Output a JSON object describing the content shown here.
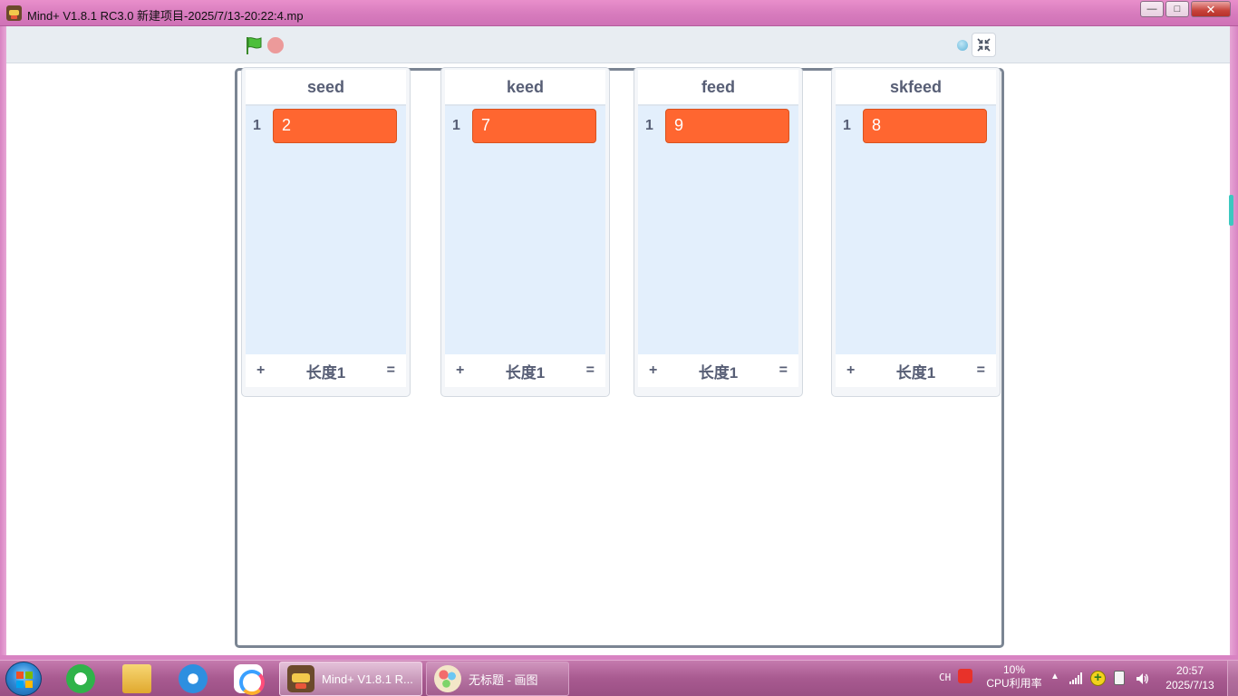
{
  "window": {
    "title": "Mind+ V1.8.1 RC3.0   新建项目-2025/7/13-20:22:4.mp",
    "minimize": "—",
    "maximize": "□",
    "close": "✕"
  },
  "toolbar": {
    "green_flag_icon": "green-flag-icon",
    "stop_icon": "stop-icon",
    "fullscreen_icon": "shrink-icon"
  },
  "lists": [
    {
      "name": "seed",
      "items": [
        {
          "index": "1",
          "value": "2"
        }
      ],
      "add": "+",
      "length": "长度1",
      "resize": "="
    },
    {
      "name": "keed",
      "items": [
        {
          "index": "1",
          "value": "7"
        }
      ],
      "add": "+",
      "length": "长度1",
      "resize": "="
    },
    {
      "name": "feed",
      "items": [
        {
          "index": "1",
          "value": "9"
        }
      ],
      "add": "+",
      "length": "长度1",
      "resize": "="
    },
    {
      "name": "skfeed",
      "items": [
        {
          "index": "1",
          "value": "8"
        }
      ],
      "add": "+",
      "length": "长度1",
      "resize": "="
    }
  ],
  "colors": {
    "item_fill": "#ff6630",
    "list_body": "#e3effc",
    "title_bar": "#d77bbd",
    "taskbar": "#a85a90"
  },
  "taskbar": {
    "tasks": [
      {
        "label": "Mind+ V1.8.1 R...",
        "icon": "mindplus-icon"
      },
      {
        "label": "无标题 - 画图",
        "icon": "paint-icon"
      }
    ],
    "ime": "CH",
    "cpu_percent": "10%",
    "cpu_label": "CPU利用率",
    "tray_arrow": "▲",
    "time": "20:57",
    "date": "2025/7/13"
  }
}
